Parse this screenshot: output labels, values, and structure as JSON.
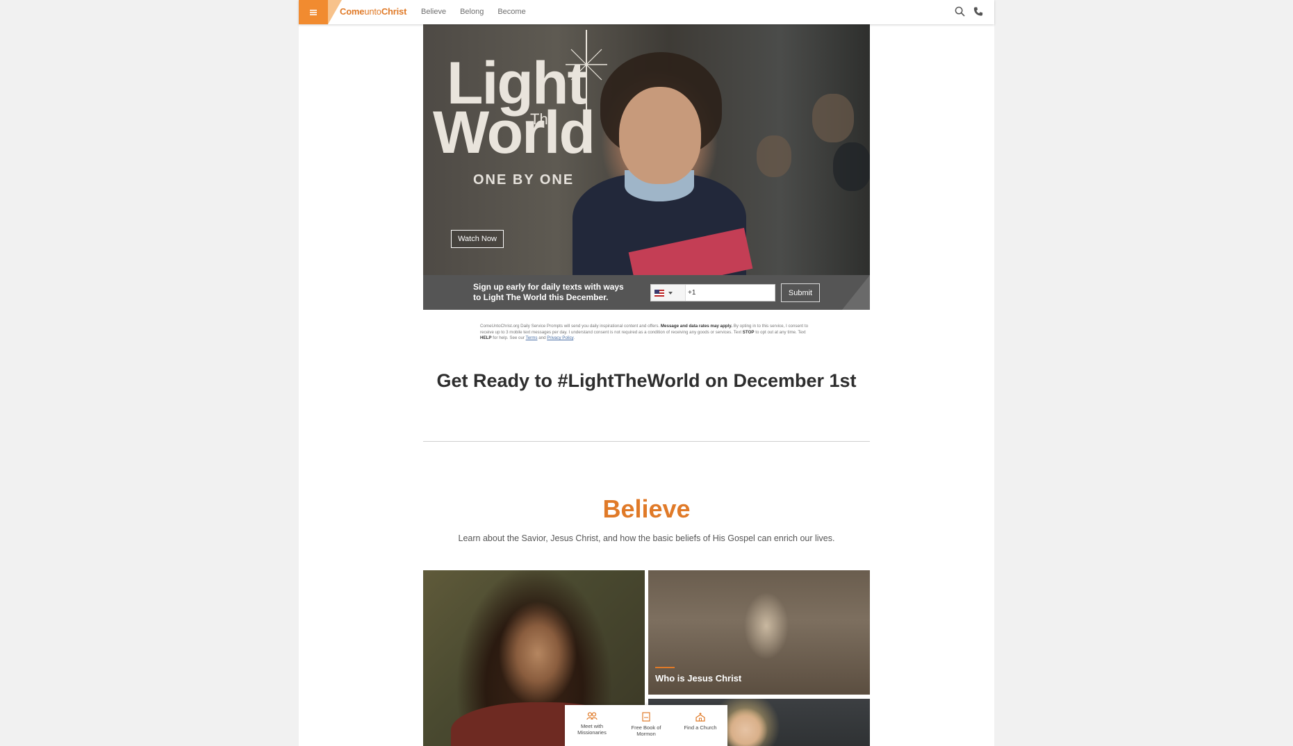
{
  "header": {
    "logo": {
      "part1": "Come",
      "part2": "unto",
      "part3": "Christ"
    },
    "nav": [
      {
        "label": "Believe"
      },
      {
        "label": "Belong"
      },
      {
        "label": "Become"
      }
    ],
    "icons": [
      "menu-icon",
      "search-icon",
      "phone-icon"
    ],
    "accent_color": "#f18b30"
  },
  "hero": {
    "title_line1": "Light",
    "title_the": "The",
    "title_line2": "World",
    "tagline": "ONE BY ONE",
    "watch_button": "Watch Now"
  },
  "signup": {
    "text": "Sign up early for daily texts with ways to Light The World this December.",
    "country_code_value": "+1",
    "submit_label": "Submit"
  },
  "disclaimer": {
    "part1": "ComeUntoChrist.org Daily Service Prompts will send you daily inspirational content and offers.",
    "bold1": "Message and data rates may apply.",
    "part2": "By opting in to this service, I consent to receive up to 3 mobile text messages per day. I understand consent is not required as a condition of receiving any goods or services. Text",
    "stop": "STOP",
    "part3": "to opt out at any time. Text",
    "help": "HELP",
    "part4": "for help. See our",
    "terms": "Terms",
    "and": "and",
    "privacy": "Privacy Policy",
    "end": "."
  },
  "get_ready": "Get Ready to #LightTheWorld on December 1st",
  "believe": {
    "title": "Believe",
    "description": "Learn about the Savior, Jesus Christ, and how the basic beliefs of His Gospel can enrich our lives.",
    "tiles": [
      {
        "label": "Who is Jesus Christ"
      }
    ]
  },
  "action_bar": [
    {
      "label": "Meet with Missionaries",
      "icon": "people-icon"
    },
    {
      "label": "Free Book of Mormon",
      "icon": "book-icon"
    },
    {
      "label": "Find a Church",
      "icon": "church-icon"
    }
  ]
}
